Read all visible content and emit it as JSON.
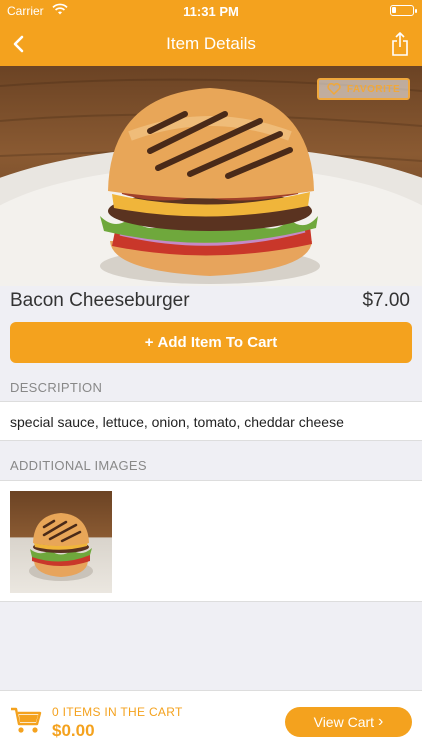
{
  "status_bar": {
    "carrier": "Carrier",
    "time": "11:31 PM",
    "battery_level": 0.2
  },
  "nav": {
    "title": "Item Details",
    "back_icon": "chevron-left-icon",
    "share_icon": "share-icon"
  },
  "hero": {
    "favorite_label": "FAVORITE",
    "favorite_icon": "heart-icon"
  },
  "item": {
    "name": "Bacon Cheeseburger",
    "price": "$7.00"
  },
  "add_button": {
    "icon": "+",
    "label": "Add Item To Cart"
  },
  "description": {
    "header": "DESCRIPTION",
    "text": "special sauce, lettuce, onion, tomato, cheddar cheese"
  },
  "additional_images": {
    "header": "ADDITIONAL IMAGES",
    "count": 1
  },
  "cart": {
    "items_label": "0 ITEMS IN THE CART",
    "total": "$0.00",
    "view_cart_label": "View Cart",
    "view_cart_chevron": "›"
  },
  "colors": {
    "accent": "#f4a21e",
    "background": "#efeff4",
    "favorite_border": "#f0a83c"
  }
}
